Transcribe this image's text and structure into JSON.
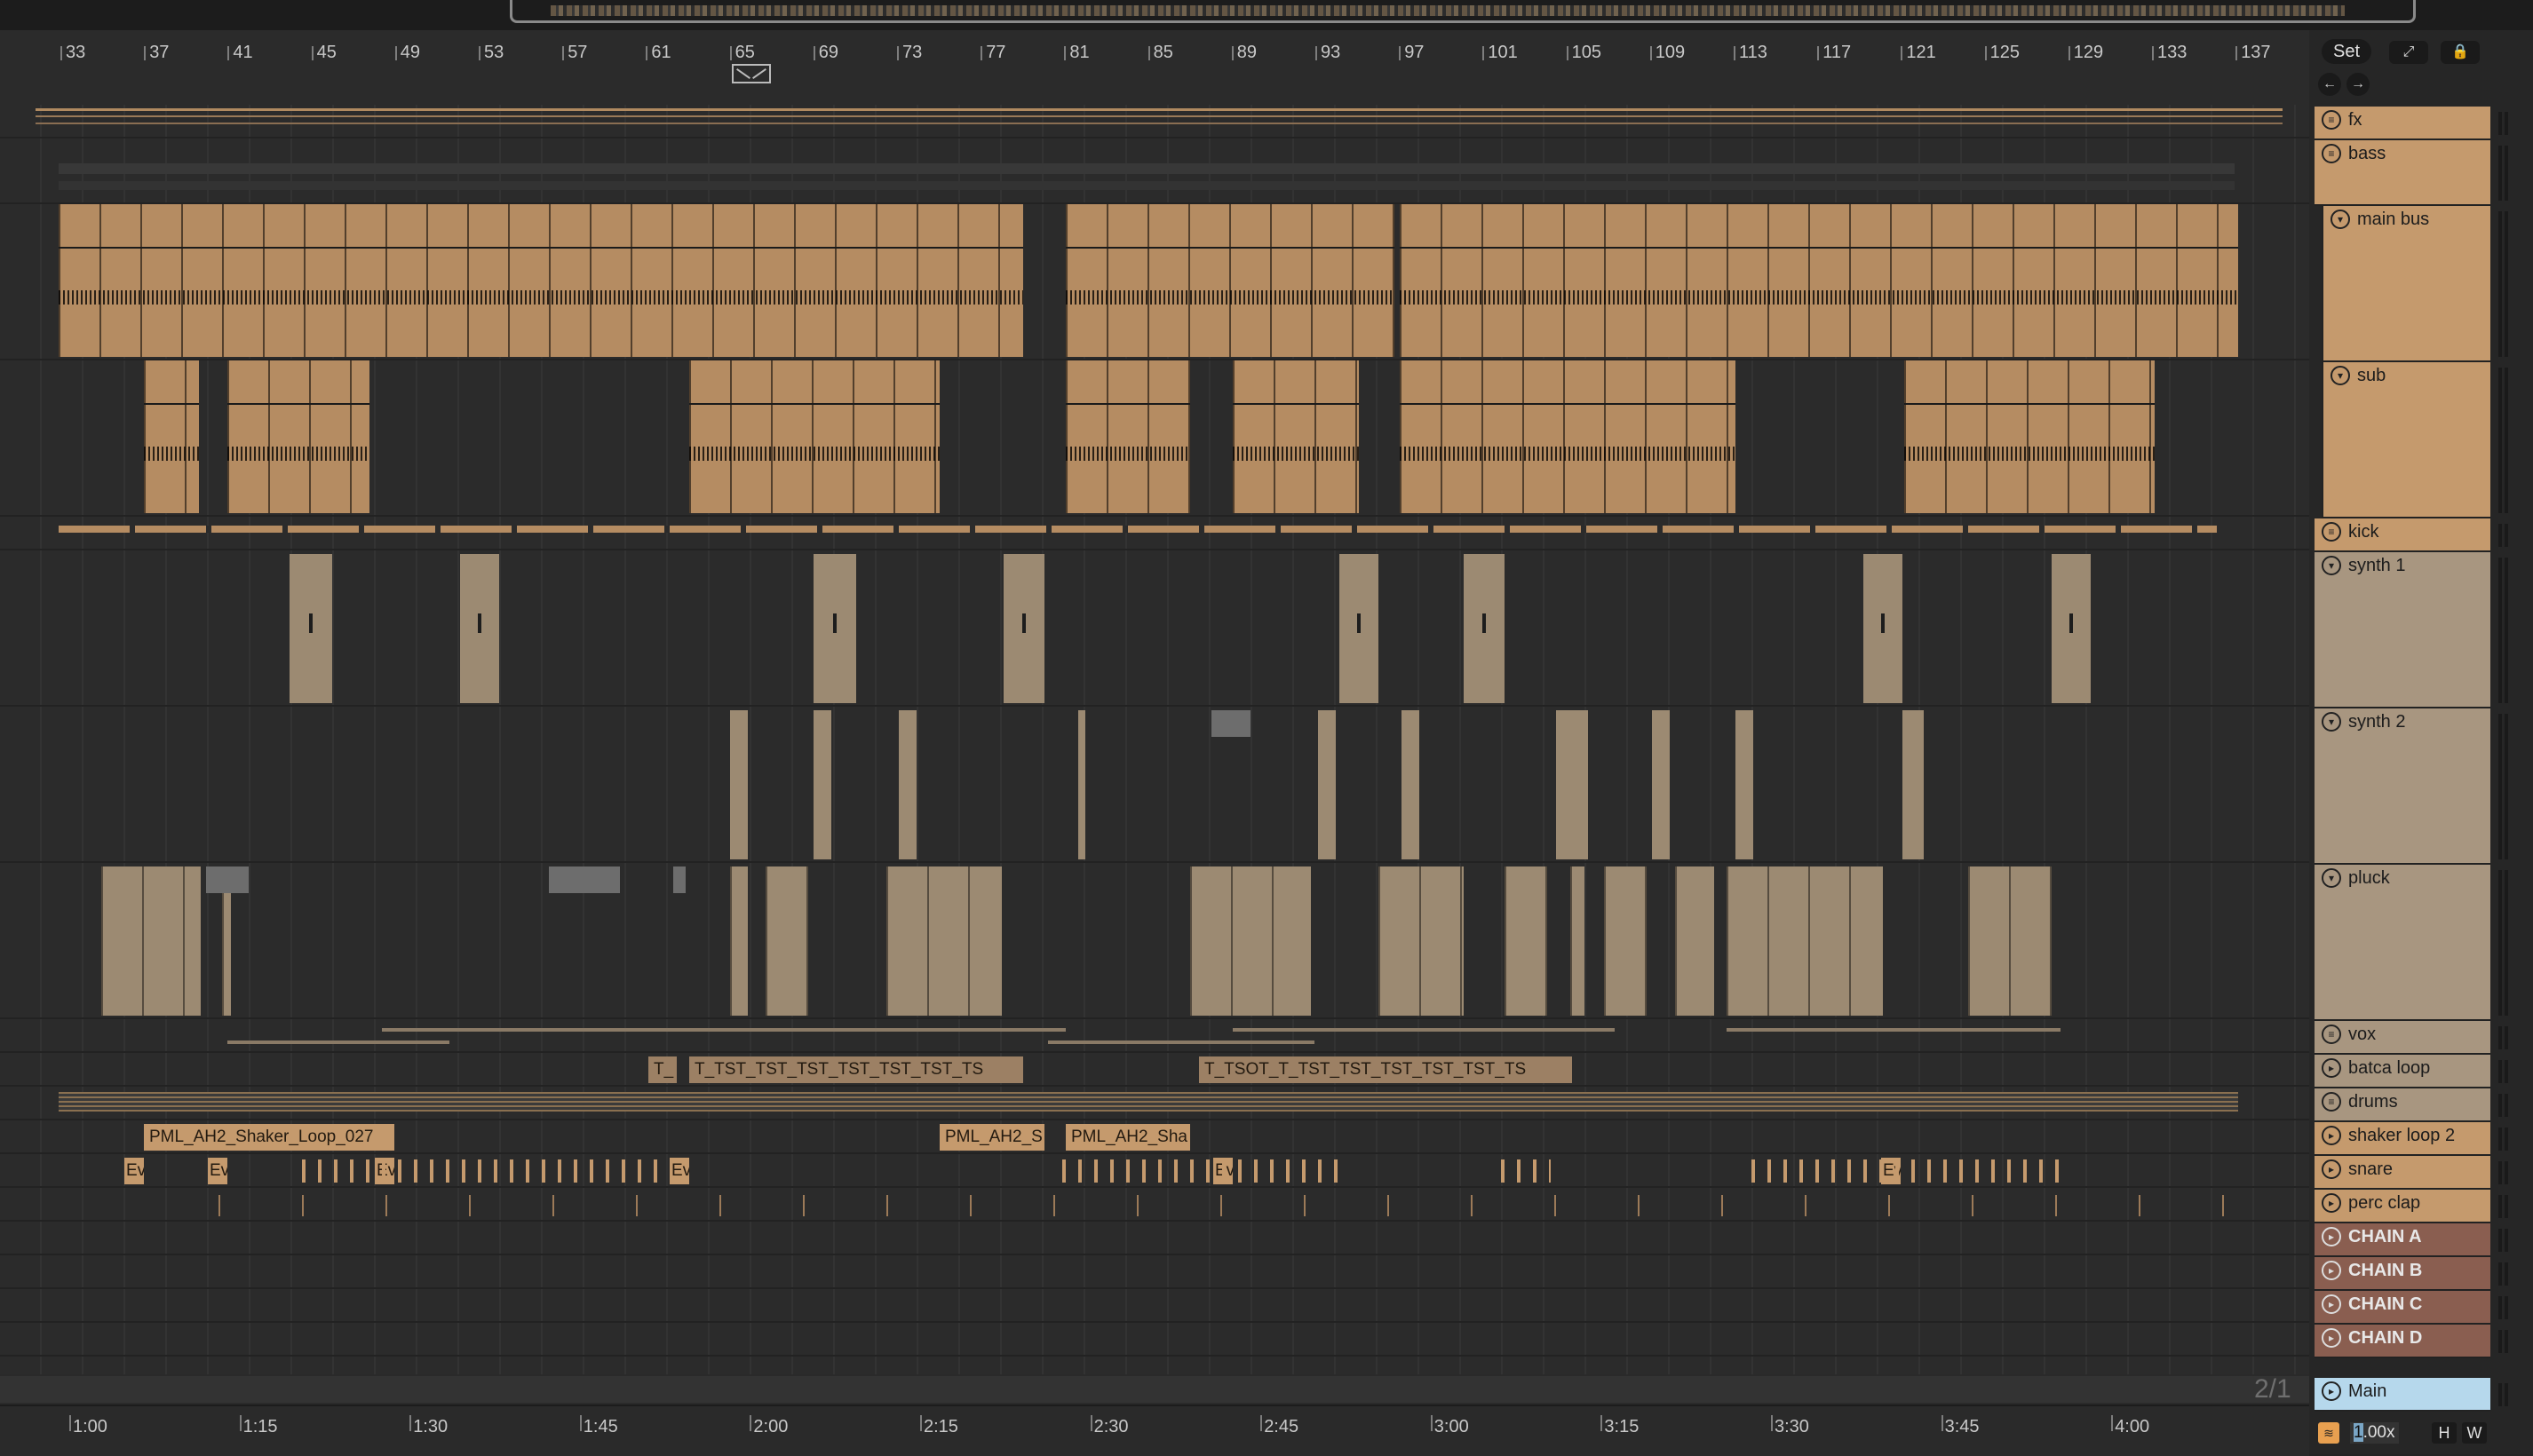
{
  "beat_ruler": [
    "33",
    "37",
    "41",
    "45",
    "49",
    "53",
    "57",
    "61",
    "65",
    "69",
    "73",
    "77",
    "81",
    "85",
    "89",
    "93",
    "97",
    "101",
    "105",
    "109",
    "113",
    "117",
    "121",
    "125",
    "129",
    "133",
    "137"
  ],
  "time_ruler": [
    "1:00",
    "1:15",
    "1:30",
    "1:45",
    "2:00",
    "2:15",
    "2:30",
    "2:45",
    "3:00",
    "3:15",
    "3:30",
    "3:45",
    "4:00"
  ],
  "controls": {
    "set_label": "Set",
    "zoom_label": "2/1",
    "tempo_prefix": "1",
    "tempo_rest": ".00x",
    "h_label": "H",
    "w_label": "W"
  },
  "tracks": [
    {
      "name": "fx",
      "icon": "group-icon"
    },
    {
      "name": "bass",
      "icon": "group-icon"
    },
    {
      "name": "main bus",
      "icon": "collapse-icon"
    },
    {
      "name": "sub",
      "icon": "collapse-icon"
    },
    {
      "name": "kick",
      "icon": "group-icon"
    },
    {
      "name": "synth 1",
      "icon": "collapse-icon"
    },
    {
      "name": "synth 2",
      "icon": "collapse-icon"
    },
    {
      "name": "pluck",
      "icon": "collapse-icon"
    },
    {
      "name": "vox",
      "icon": "group-icon"
    },
    {
      "name": "batca loop",
      "icon": "play-icon"
    },
    {
      "name": "drums",
      "icon": "group-icon"
    },
    {
      "name": "shaker loop 2",
      "icon": "play-icon"
    },
    {
      "name": "snare",
      "icon": "play-icon"
    },
    {
      "name": "perc clap",
      "icon": "play-icon"
    },
    {
      "name": "CHAIN A",
      "icon": "play-icon"
    },
    {
      "name": "CHAIN B",
      "icon": "play-icon"
    },
    {
      "name": "CHAIN C",
      "icon": "play-icon"
    },
    {
      "name": "CHAIN D",
      "icon": "play-icon"
    },
    {
      "name": "Main",
      "icon": "play-icon"
    }
  ],
  "clips": {
    "shaker_1": "PML_AH2_Shaker_Loop_027",
    "shaker_2": "PML_AH2_S",
    "shaker_3": "PML_AH2_Sha",
    "batca_1": "T_",
    "batca_2": "T_TST_TST_TST_TST_TST_TST_TS",
    "batca_3": "T_TSOT_T_TST_TST_TST_TST_TST_TS",
    "snare_a": "Ev",
    "snare_b": "Ev",
    "snare_c": "Ev",
    "snare_d": "Ev",
    "snare_e": "Ev",
    "snare_f": "Ev"
  }
}
